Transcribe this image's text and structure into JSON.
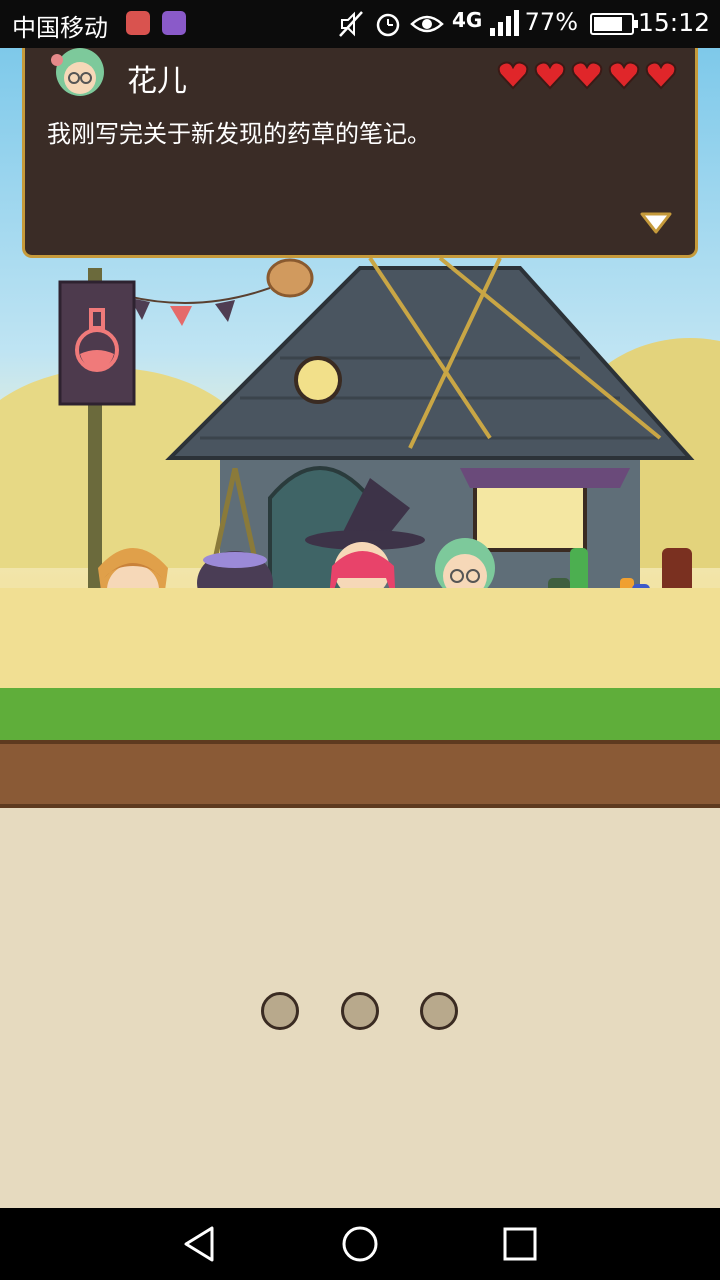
{
  "status_bar": {
    "carrier": "中国移动",
    "network": "4G",
    "battery_percent": "77%",
    "time": "15:12",
    "icons": [
      "notification-app-icon",
      "gallery-app-icon",
      "mute-icon",
      "alarm-icon",
      "eye-icon",
      "data-4g-icon",
      "signal-icon",
      "battery-icon"
    ]
  },
  "dialog": {
    "speaker": "花儿",
    "text": "我刚写完关于新发现的药草的笔记。",
    "hearts_filled": 5,
    "hearts_total": 5
  },
  "scene": {
    "shop_sign": "potion-flask-icon"
  },
  "pager": {
    "pages": 3
  },
  "nav": {
    "buttons": [
      "back-icon",
      "home-icon",
      "recents-icon"
    ]
  },
  "colors": {
    "dialog_bg": "#3a2c26",
    "dialog_border": "#c59a3b",
    "heart": "#e0262a",
    "panel_bg": "#e6dabf"
  }
}
